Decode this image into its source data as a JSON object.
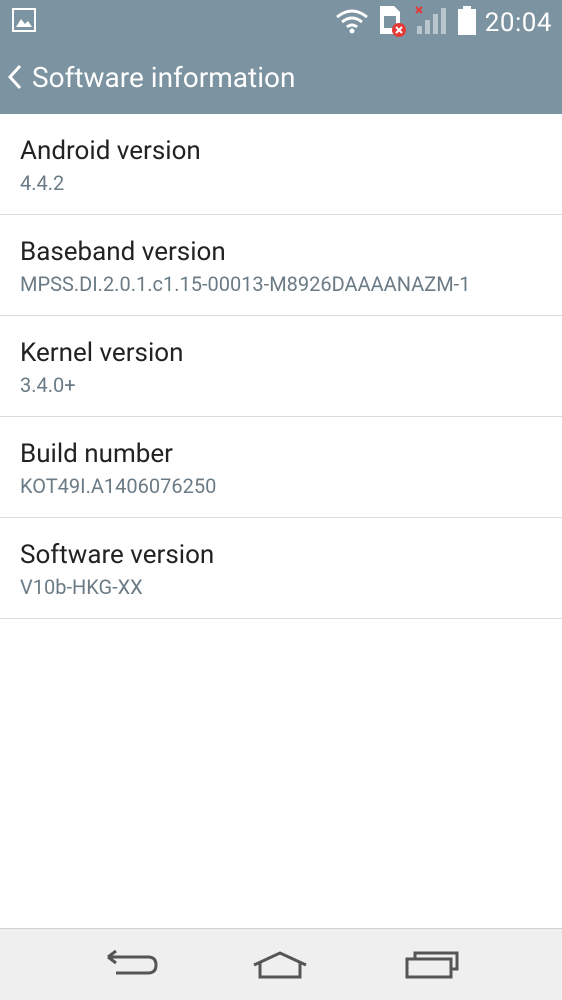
{
  "status": {
    "time": "20:04"
  },
  "header": {
    "title": "Software information"
  },
  "items": [
    {
      "label": "Android version",
      "value": "4.4.2"
    },
    {
      "label": "Baseband version",
      "value": "MPSS.DI.2.0.1.c1.15-00013-M8926DAAAANAZM-1"
    },
    {
      "label": "Kernel version",
      "value": "3.4.0+"
    },
    {
      "label": "Build number",
      "value": "KOT49I.A1406076250"
    },
    {
      "label": "Software version",
      "value": "V10b-HKG-XX"
    }
  ],
  "icons": {
    "status_left": "gallery-icon",
    "status_right": [
      "wifi-icon",
      "sim-error-icon",
      "signal-icon",
      "battery-icon"
    ],
    "nav": [
      "back-icon",
      "home-icon",
      "recent-apps-icon"
    ]
  },
  "colors": {
    "header": "#7c93a1",
    "value_text": "#6b7b86",
    "divider": "#dcdcdc"
  }
}
